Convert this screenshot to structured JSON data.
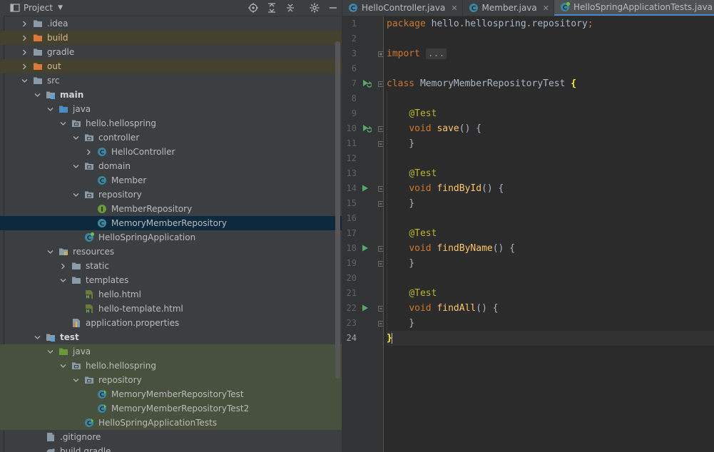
{
  "project_panel": {
    "title": "Project",
    "tree": [
      {
        "label": ".idea",
        "depth": 0,
        "arrow": "right",
        "icon": "folder",
        "state": ""
      },
      {
        "label": "build",
        "depth": 0,
        "arrow": "right",
        "icon": "folder-orange",
        "state": "excluded"
      },
      {
        "label": "gradle",
        "depth": 0,
        "arrow": "right",
        "icon": "folder",
        "state": ""
      },
      {
        "label": "out",
        "depth": 0,
        "arrow": "right",
        "icon": "folder-orange",
        "state": "excluded"
      },
      {
        "label": "src",
        "depth": 0,
        "arrow": "down",
        "icon": "folder",
        "state": ""
      },
      {
        "label": "main",
        "depth": 1,
        "arrow": "down",
        "icon": "folder-module",
        "state": "bold"
      },
      {
        "label": "java",
        "depth": 2,
        "arrow": "down",
        "icon": "folder-blue",
        "state": ""
      },
      {
        "label": "hello.hellospring",
        "depth": 3,
        "arrow": "down",
        "icon": "package",
        "state": ""
      },
      {
        "label": "controller",
        "depth": 4,
        "arrow": "down",
        "icon": "package",
        "state": ""
      },
      {
        "label": "HelloController",
        "depth": 5,
        "arrow": "right",
        "icon": "class",
        "state": ""
      },
      {
        "label": "domain",
        "depth": 4,
        "arrow": "down",
        "icon": "package",
        "state": ""
      },
      {
        "label": "Member",
        "depth": 5,
        "arrow": "",
        "icon": "class",
        "state": ""
      },
      {
        "label": "repository",
        "depth": 4,
        "arrow": "down",
        "icon": "package",
        "state": ""
      },
      {
        "label": "MemberRepository",
        "depth": 5,
        "arrow": "",
        "icon": "interface",
        "state": ""
      },
      {
        "label": "MemoryMemberRepository",
        "depth": 5,
        "arrow": "",
        "icon": "class",
        "state": "selected"
      },
      {
        "label": "HelloSpringApplication",
        "depth": 4,
        "arrow": "",
        "icon": "spring-class",
        "state": ""
      },
      {
        "label": "resources",
        "depth": 2,
        "arrow": "down",
        "icon": "folder-resources",
        "state": ""
      },
      {
        "label": "static",
        "depth": 3,
        "arrow": "right",
        "icon": "folder",
        "state": ""
      },
      {
        "label": "templates",
        "depth": 3,
        "arrow": "down",
        "icon": "folder",
        "state": ""
      },
      {
        "label": "hello.html",
        "depth": 4,
        "arrow": "",
        "icon": "html",
        "state": ""
      },
      {
        "label": "hello-template.html",
        "depth": 4,
        "arrow": "",
        "icon": "html",
        "state": ""
      },
      {
        "label": "application.properties",
        "depth": 3,
        "arrow": "",
        "icon": "properties",
        "state": ""
      },
      {
        "label": "test",
        "depth": 1,
        "arrow": "down",
        "icon": "folder-module",
        "state": "bold"
      },
      {
        "label": "java",
        "depth": 2,
        "arrow": "down",
        "icon": "folder-green",
        "state": "testbg"
      },
      {
        "label": "hello.hellospring",
        "depth": 3,
        "arrow": "down",
        "icon": "package",
        "state": "testbg"
      },
      {
        "label": "repository",
        "depth": 4,
        "arrow": "down",
        "icon": "package",
        "state": "testbg"
      },
      {
        "label": "MemoryMemberRepositoryTest",
        "depth": 5,
        "arrow": "",
        "icon": "test-class",
        "state": "testbg"
      },
      {
        "label": "MemoryMemberRepositoryTest2",
        "depth": 5,
        "arrow": "",
        "icon": "test-class",
        "state": "testbg"
      },
      {
        "label": "HelloSpringApplicationTests",
        "depth": 4,
        "arrow": "",
        "icon": "test-class",
        "state": "testbg"
      },
      {
        "label": ".gitignore",
        "depth": 1,
        "arrow": "",
        "icon": "file",
        "state": ""
      },
      {
        "label": "build.gradle",
        "depth": 1,
        "arrow": "",
        "icon": "gradle",
        "state": ""
      }
    ]
  },
  "tabs": [
    {
      "label": "HelloController.java",
      "active": false
    },
    {
      "label": "Member.java",
      "active": false
    },
    {
      "label": "HelloSpringApplicationTests.java",
      "active": true
    }
  ],
  "editor": {
    "current_line": 24,
    "lines": [
      {
        "n": 1,
        "tokens": [
          [
            "kw",
            "package "
          ],
          [
            "",
            "hello.hellospring.repository"
          ],
          [
            "kw",
            ";"
          ]
        ]
      },
      {
        "n": 2,
        "tokens": []
      },
      {
        "n": 3,
        "tokens": [
          [
            "kw",
            "import "
          ],
          [
            "dots",
            "..."
          ]
        ]
      },
      {
        "n": 6,
        "tokens": []
      },
      {
        "n": 7,
        "tokens": [
          [
            "kw",
            "class "
          ],
          [
            "",
            "MemoryMemberRepositoryTest "
          ],
          [
            "brace",
            "{"
          ]
        ]
      },
      {
        "n": 8,
        "tokens": []
      },
      {
        "n": 9,
        "tokens": [
          [
            "",
            "    "
          ],
          [
            "an",
            "@Test"
          ]
        ]
      },
      {
        "n": 10,
        "tokens": [
          [
            "",
            "    "
          ],
          [
            "kw",
            "void "
          ],
          [
            "fn",
            "save"
          ],
          [
            "",
            "() {"
          ]
        ]
      },
      {
        "n": 11,
        "tokens": [
          [
            "",
            "    }"
          ]
        ]
      },
      {
        "n": 12,
        "tokens": []
      },
      {
        "n": 13,
        "tokens": [
          [
            "",
            "    "
          ],
          [
            "an",
            "@Test"
          ]
        ]
      },
      {
        "n": 14,
        "tokens": [
          [
            "",
            "    "
          ],
          [
            "kw",
            "void "
          ],
          [
            "fn",
            "findById"
          ],
          [
            "",
            "() {"
          ]
        ]
      },
      {
        "n": 15,
        "tokens": [
          [
            "",
            "    }"
          ]
        ]
      },
      {
        "n": 16,
        "tokens": []
      },
      {
        "n": 17,
        "tokens": [
          [
            "",
            "    "
          ],
          [
            "an",
            "@Test"
          ]
        ]
      },
      {
        "n": 18,
        "tokens": [
          [
            "",
            "    "
          ],
          [
            "kw",
            "void "
          ],
          [
            "fn",
            "findByName"
          ],
          [
            "",
            "() {"
          ]
        ]
      },
      {
        "n": 19,
        "tokens": [
          [
            "",
            "    }"
          ]
        ]
      },
      {
        "n": 20,
        "tokens": []
      },
      {
        "n": 21,
        "tokens": [
          [
            "",
            "    "
          ],
          [
            "an",
            "@Test"
          ]
        ]
      },
      {
        "n": 22,
        "tokens": [
          [
            "",
            "    "
          ],
          [
            "kw",
            "void "
          ],
          [
            "fn",
            "findAll"
          ],
          [
            "",
            "() {"
          ]
        ]
      },
      {
        "n": 23,
        "tokens": [
          [
            "",
            "    }"
          ]
        ]
      },
      {
        "n": 24,
        "tokens": [
          [
            "brace",
            "}"
          ]
        ]
      }
    ],
    "run_markers": [
      {
        "line": 7,
        "type": "run-all"
      },
      {
        "line": 10,
        "type": "run-all"
      },
      {
        "line": 14,
        "type": "run"
      },
      {
        "line": 18,
        "type": "run"
      },
      {
        "line": 22,
        "type": "run"
      }
    ]
  },
  "colors": {
    "keyword": "#cc7832",
    "annotation": "#bbb529",
    "method": "#ffc66d",
    "text": "#a9b7c6",
    "selection": "#0d293e"
  }
}
